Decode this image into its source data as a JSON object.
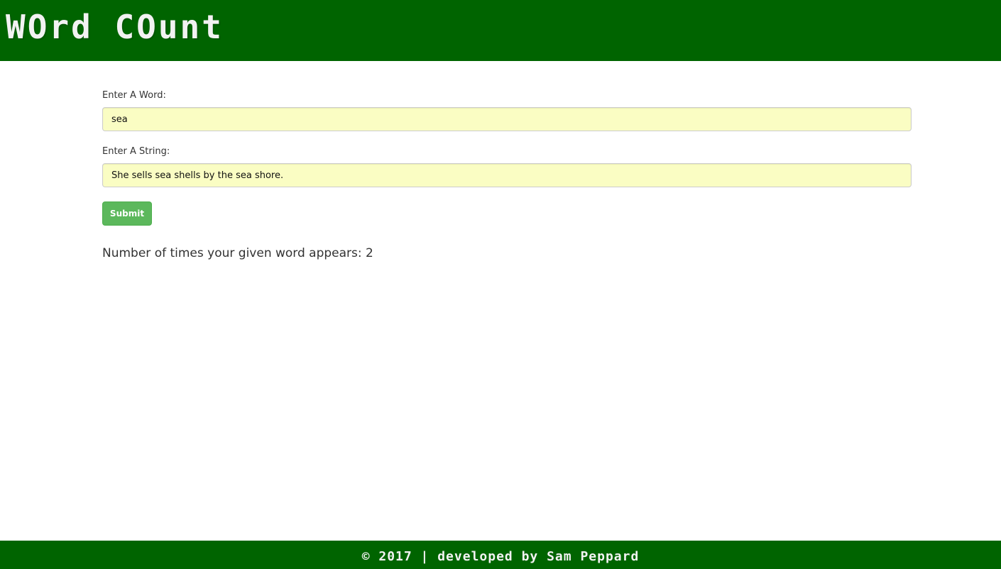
{
  "header": {
    "title": "WOrd COunt"
  },
  "form": {
    "word_label": "Enter A Word:",
    "word_value": "sea",
    "string_label": "Enter A String:",
    "string_value": "She sells sea shells by the sea shore.",
    "submit_label": "Submit"
  },
  "result": {
    "prefix": "Number of times your given word appears:",
    "count": "2"
  },
  "footer": {
    "text": "© 2017 | developed by Sam Peppard"
  },
  "colors": {
    "header_bg": "#006400",
    "footer_bg": "#006400",
    "input_bg": "#fafdc3",
    "submit_bg": "#5cb85c"
  }
}
